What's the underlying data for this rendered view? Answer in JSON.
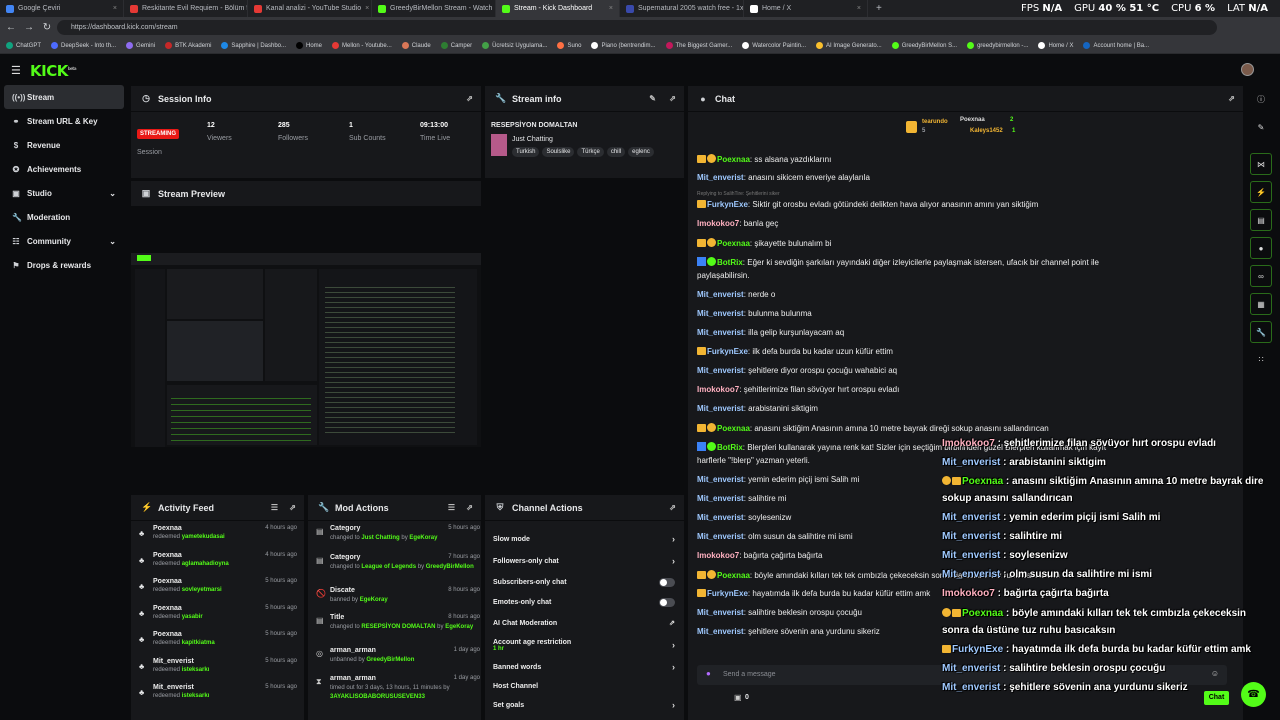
{
  "browser": {
    "tabs": [
      {
        "title": "Google Çeviri",
        "color": "#4285f4"
      },
      {
        "title": "Reskitante Evil Requiem - Bölüm 5",
        "color": "#e53935"
      },
      {
        "title": "Kanal analizi - YouTube Studio",
        "color": "#e53935"
      },
      {
        "title": "GreedyBirMellon Stream - Watch",
        "color": "#53fc18"
      },
      {
        "title": "Stream - Kick Dashboard",
        "color": "#53fc18"
      },
      {
        "title": "Supernatural 2005 watch free - 1x",
        "color": "#3949ab"
      },
      {
        "title": "Home / X",
        "color": "#ffffff"
      }
    ],
    "url": "https://dashboard.kick.com/stream",
    "osd": {
      "fps_label": "FPS",
      "fps": "N/A",
      "gpu_label": "GPU",
      "gpu": "40 % 51 °C",
      "cpu_label": "CPU",
      "cpu": "6 %",
      "lat_label": "LAT",
      "lat": "N/A"
    },
    "bookmarks": [
      "ChatGPT",
      "DeepSeek - Into th...",
      "Gemini",
      "BTK Akademi",
      "Sapphire | Dashbo...",
      "Home",
      "Mellon - Youtube...",
      "Claude",
      "Camper",
      "Ücretsiz Uygulama...",
      "Suno",
      "Piano (bentrendim...",
      "The Biggest Gamer...",
      "Watercolor Paintin...",
      "AI Image Generato...",
      "GreedyBirMellon S...",
      "greedybirmellon -...",
      "Home / X",
      "Account home | Ba..."
    ]
  },
  "app": {
    "logo": "KICK",
    "logo_sup": "beta"
  },
  "sidebar": {
    "items": [
      {
        "label": "Stream",
        "icon": "stream-icon"
      },
      {
        "label": "Stream URL & Key",
        "icon": "link-icon"
      },
      {
        "label": "Revenue",
        "icon": "dollar-icon"
      },
      {
        "label": "Achievements",
        "icon": "achievement-icon"
      },
      {
        "label": "Studio",
        "icon": "studio-icon"
      },
      {
        "label": "Moderation",
        "icon": "wrench-icon"
      },
      {
        "label": "Community",
        "icon": "community-icon"
      },
      {
        "label": "Drops & rewards",
        "icon": "gift-icon"
      }
    ]
  },
  "session": {
    "title": "Session Info",
    "status": "STREAMING",
    "status_label": "Session",
    "viewers": "12",
    "viewers_label": "Viewers",
    "followers": "285",
    "followers_label": "Followers",
    "subs": "1",
    "subs_label": "Sub Counts",
    "time": "09:13:00",
    "time_label": "Time Live"
  },
  "stream_info": {
    "title": "Stream info",
    "stream_title": "RESEPSİYON DOMALTAN",
    "category": "Just Chatting",
    "tags": [
      "Turkish",
      "Soulslike",
      "Türkçe",
      "chill",
      "eglenc"
    ]
  },
  "preview": {
    "title": "Stream Preview"
  },
  "activity": {
    "title": "Activity Feed",
    "items": [
      {
        "name": "Poexnaa",
        "verb": "redeemed",
        "reward": "yametekudasai",
        "time": "4 hours ago"
      },
      {
        "name": "Poexnaa",
        "verb": "redeemed",
        "reward": "aglamahadioyna",
        "time": "4 hours ago"
      },
      {
        "name": "Poexnaa",
        "verb": "redeemed",
        "reward": "sovleyetmarsi",
        "time": "5 hours ago"
      },
      {
        "name": "Poexnaa",
        "verb": "redeemed",
        "reward": "yasabir",
        "time": "5 hours ago"
      },
      {
        "name": "Poexnaa",
        "verb": "redeemed",
        "reward": "kapitkiatma",
        "time": "5 hours ago"
      },
      {
        "name": "Mit_enverist",
        "verb": "redeemed",
        "reward": "isteksarkı",
        "time": "5 hours ago"
      },
      {
        "name": "Mit_enverist",
        "verb": "redeemed",
        "reward": "isteksarkı",
        "time": "5 hours ago"
      }
    ]
  },
  "mod_actions": {
    "title": "Mod Actions",
    "items": [
      {
        "title": "Category",
        "line1": "changed to",
        "hl1": "Just Chatting",
        "line2": "by",
        "hl2": "EgeKoray",
        "time": "5 hours ago"
      },
      {
        "title": "Category",
        "line1": "changed to",
        "hl1": "League of Legends",
        "line2": "by",
        "hl2": "GreedyBirMellon",
        "time": "7 hours ago"
      },
      {
        "title": "Discate",
        "line1": "banned by",
        "hl1": "EgeKoray",
        "line2": "",
        "hl2": "",
        "time": "8 hours ago"
      },
      {
        "title": "Title",
        "line1": "changed to",
        "hl1": "RESEPSİYON DOMALTAN",
        "line2": "by",
        "hl2": "EgeKoray",
        "time": "8 hours ago"
      },
      {
        "title": "arman_arman",
        "line1": "unbanned by",
        "hl1": "GreedyBirMellon",
        "line2": "",
        "hl2": "",
        "time": "1 day ago"
      },
      {
        "title": "arman_arman",
        "line1": "timed out for 3 days, 13 hours, 11 minutes by",
        "hl1": "3AYAKLISOBABORUSUSEVEN33",
        "line2": "",
        "hl2": "",
        "time": "1 day ago"
      }
    ]
  },
  "channel_actions": {
    "title": "Channel Actions",
    "items": [
      {
        "label": "Slow mode",
        "ctrl": "arrow"
      },
      {
        "label": "Followers-only chat",
        "ctrl": "arrow"
      },
      {
        "label": "Subscribers-only chat",
        "ctrl": "toggle"
      },
      {
        "label": "Emotes-only chat",
        "ctrl": "toggle"
      },
      {
        "label": "AI Chat Moderation",
        "ctrl": "ext"
      },
      {
        "label": "Account age restriction",
        "sub": "1 hr",
        "ctrl": "arrow"
      },
      {
        "label": "Banned words",
        "ctrl": "arrow"
      },
      {
        "label": "Host Channel",
        "ctrl": "none"
      },
      {
        "label": "Set goals",
        "ctrl": "arrow"
      }
    ]
  },
  "chat": {
    "title": "Chat",
    "top": {
      "user1": "tearundo",
      "user1_count": "5",
      "user2": "Poexnaa",
      "user2_count": "2",
      "user3": "Kaleys1452",
      "user3_count": "1"
    },
    "reply_note": "Replying to SalihTire: Şehitlerini siker",
    "input_placeholder": "Send a message",
    "points": "0",
    "send_label": "Chat",
    "messages": [
      {
        "user": "Poexnaa",
        "color": "g",
        "badges": [
          "crown",
          "gold"
        ],
        "text": "ss alsana yazdıklarını"
      },
      {
        "user": "Mit_enverist",
        "color": "b",
        "badges": [],
        "text": "anasını sikicem enveriye alaylarıla"
      },
      {
        "user": "FurkynExe",
        "color": "b",
        "badges": [
          "crown"
        ],
        "text": "Siktir git orosbu evladı götündeki delikten hava alıyor anasının amını yan siktiğim"
      },
      {
        "user": "Imokokoo7",
        "color": "p",
        "badges": [],
        "text": "banla geç"
      },
      {
        "user": "Poexnaa",
        "color": "g",
        "badges": [
          "crown",
          "gold"
        ],
        "text": "şikayette bulunalım bi"
      },
      {
        "user": "BotRix",
        "color": "g",
        "badges": [
          "blue",
          "check"
        ],
        "text": "Eğer ki sevdiğin şarkıları yayındaki diğer izleyicilerle paylaşmak istersen, ufacık bir channel point ile"
      },
      {
        "user": "",
        "color": "b",
        "badges": [],
        "text": "paylaşabilirsin."
      },
      {
        "user": "Mit_enverist",
        "color": "b",
        "badges": [],
        "text": "nerde o"
      },
      {
        "user": "Mit_enverist",
        "color": "b",
        "badges": [],
        "text": "bulunma bulunma"
      },
      {
        "user": "Mit_enverist",
        "color": "b",
        "badges": [],
        "text": "illa gelip kurşunlayacam aq"
      },
      {
        "user": "FurkynExe",
        "color": "b",
        "badges": [
          "crown"
        ],
        "text": "ilk defa burda bu kadar uzun küfür ettim"
      },
      {
        "user": "Mit_enverist",
        "color": "b",
        "badges": [],
        "text": "şehitlere diyor orospu çocuğu wahabici aq"
      },
      {
        "user": "Imokokoo7",
        "color": "p",
        "badges": [],
        "text": "şehitlerimize filan sövüyor hırt orospu evladı"
      },
      {
        "user": "Mit_enverist",
        "color": "b",
        "badges": [],
        "text": "arabistanini siktigim"
      },
      {
        "user": "Poexnaa",
        "color": "g",
        "badges": [
          "crown",
          "gold"
        ],
        "text": "anasını siktiğim Anasının amına 10 metre bayrak direği sokup anasını sallandırıcan"
      },
      {
        "user": "BotRix",
        "color": "g",
        "badges": [
          "blue",
          "check"
        ],
        "text": "Blerpleri kullanarak yayına renk kat! Sizler için seçtiğim birbirinden güzel Blerpleri kullanmak için kayıt"
      },
      {
        "user": "",
        "color": "b",
        "badges": [],
        "text": "harflerle \"!blerp\" yazman yeterli."
      },
      {
        "user": "Mit_enverist",
        "color": "b",
        "badges": [],
        "text": "yemin ederim piçij ismi Salih mi"
      },
      {
        "user": "Mit_enverist",
        "color": "b",
        "badges": [],
        "text": "salihtire mi"
      },
      {
        "user": "Mit_enverist",
        "color": "b",
        "badges": [],
        "text": "soylesenizw"
      },
      {
        "user": "Mit_enverist",
        "color": "b",
        "badges": [],
        "text": "olm susun da salihtire mi ismi"
      },
      {
        "user": "Imokokoo7",
        "color": "p",
        "badges": [],
        "text": "bağırta çağırta bağırta"
      },
      {
        "user": "Poexnaa",
        "color": "g",
        "badges": [
          "crown",
          "gold"
        ],
        "text": "böyle amındaki kılları tek tek cımbızla çekeceksin sonra da üstüne tuz ruhu basıcaksın"
      },
      {
        "user": "FurkynExe",
        "color": "b",
        "badges": [
          "crown"
        ],
        "text": "hayatımda ilk defa burda bu kadar küfür ettim amk"
      },
      {
        "user": "Mit_enverist",
        "color": "b",
        "badges": [],
        "text": "salihtire beklesin orospu çocuğu"
      },
      {
        "user": "Mit_enverist",
        "color": "b",
        "badges": [],
        "text": "şehitlere sövenin ana yurdunu sikeriz"
      }
    ]
  },
  "overlay": [
    {
      "user": "Imokokoo7",
      "color": "up",
      "badges": [],
      "text": ": şehitlerimize filan sövüyor hırt orospu evladı"
    },
    {
      "user": "Mit_enverist",
      "color": "ub",
      "badges": [],
      "text": ": arabistanini siktigim"
    },
    {
      "user": "Poexnaa",
      "color": "ug",
      "badges": [
        "gold",
        "crown"
      ],
      "text": ": anasını siktiğim Anasının amına 10 metre bayrak dire"
    },
    {
      "user": "",
      "color": "ub",
      "badges": [],
      "text": "sokup anasını sallandırıcan"
    },
    {
      "user": "Mit_enverist",
      "color": "ub",
      "badges": [],
      "text": ": yemin ederim piçij ismi Salih mi"
    },
    {
      "user": "Mit_enverist",
      "color": "ub",
      "badges": [],
      "text": ": salihtire mi"
    },
    {
      "user": "Mit_enverist",
      "color": "ub",
      "badges": [],
      "text": ": soylesenizw"
    },
    {
      "user": "Mit_enverist",
      "color": "ub",
      "badges": [],
      "text": ": olm susun da salihtire mi ismi"
    },
    {
      "user": "Imokokoo7",
      "color": "up",
      "badges": [],
      "text": ": bağırta çağırta bağırta"
    },
    {
      "user": "Poexnaa",
      "color": "ug",
      "badges": [
        "gold",
        "crown"
      ],
      "text": ": böyle amındaki kılları tek tek cımbızla çekeceksin"
    },
    {
      "user": "",
      "color": "ub",
      "badges": [],
      "text": "sonra da üstüne tuz ruhu basıcaksın"
    },
    {
      "user": "FurkynExe",
      "color": "ub",
      "badges": [
        "crown"
      ],
      "text": ": hayatımda ilk defa burda bu kadar küfür ettim amk"
    },
    {
      "user": "Mit_enverist",
      "color": "ub",
      "badges": [],
      "text": ": salihtire beklesin orospu çocuğu"
    },
    {
      "user": "Mit_enverist",
      "color": "ub",
      "badges": [],
      "text": ": şehitlere sövenin ana yurdunu sikeriz"
    }
  ],
  "colors": {
    "accent": "#53fc18",
    "live": "#e91916",
    "panel": "#17181b",
    "bg": "#0b0c0e"
  }
}
